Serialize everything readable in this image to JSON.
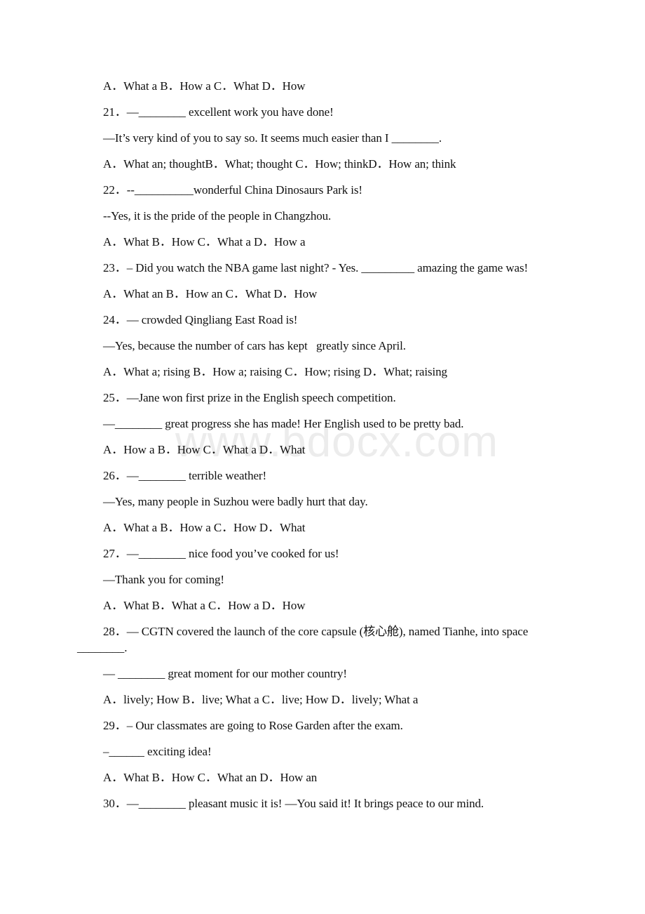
{
  "watermark": "www.bdocx.com",
  "paragraphs": [
    {
      "type": "options",
      "text": "A．What a B．How a C．What D．How"
    },
    {
      "type": "question",
      "number": "21",
      "text": "21．—________ excellent work you have done!"
    },
    {
      "type": "response",
      "text": "—It’s very kind of you to say so. It seems much easier than I ________."
    },
    {
      "type": "options",
      "text": "A．What an; thoughtB．What; thought C．How; thinkD．How an; think"
    },
    {
      "type": "question",
      "number": "22",
      "text": "22．--__________wonderful China Dinosaurs Park is!"
    },
    {
      "type": "response",
      "text": "--Yes, it is the pride of the people in Changzhou."
    },
    {
      "type": "options",
      "text": "A．What B．How C．What a D．How a"
    },
    {
      "type": "question",
      "number": "23",
      "text": "23．– Did you watch the NBA game last night? - Yes. _________ amazing the game was!"
    },
    {
      "type": "options",
      "text": "A．What an B．How an C．What D．How"
    },
    {
      "type": "question",
      "number": "24",
      "text": "24．— crowded Qingliang East Road is!"
    },
    {
      "type": "response",
      "text": "—Yes, because the number of cars has kept   greatly since April."
    },
    {
      "type": "options",
      "text": "A．What a; rising B．How a; raising C．How; rising D．What; raising"
    },
    {
      "type": "question",
      "number": "25",
      "text": "25．—Jane won first prize in the English speech competition."
    },
    {
      "type": "response",
      "text": "—________ great progress she has made! Her English used to be pretty bad."
    },
    {
      "type": "options",
      "text": "A．How a B．How C．What a D．What"
    },
    {
      "type": "question",
      "number": "26",
      "text": "26．—________ terrible weather!"
    },
    {
      "type": "response",
      "text": "—Yes, many people in Suzhou were badly hurt that day."
    },
    {
      "type": "options",
      "text": "A．What a B．How a C．How D．What"
    },
    {
      "type": "question",
      "number": "27",
      "text": "27．—________ nice food you’ve cooked for us!"
    },
    {
      "type": "response",
      "text": "—Thank you for coming!"
    },
    {
      "type": "options",
      "text": "A．What B．What a C．How a D．How"
    },
    {
      "type": "question",
      "number": "28",
      "text": "28．— CGTN covered the launch of the core capsule (核心舱), named Tianhe, into space ________."
    },
    {
      "type": "response",
      "text": "— ________ great moment for our mother country!"
    },
    {
      "type": "options",
      "text": "A．lively; How B．live; What a C．live; How D．lively; What a"
    },
    {
      "type": "question",
      "number": "29",
      "text": "29．– Our classmates are going to Rose Garden after the exam."
    },
    {
      "type": "response",
      "text": "–______ exciting idea!"
    },
    {
      "type": "options",
      "text": "A．What B．How C．What an D．How an"
    },
    {
      "type": "question",
      "number": "30",
      "text": "30．—________ pleasant music it is! —You said it! It brings peace to our mind."
    }
  ]
}
